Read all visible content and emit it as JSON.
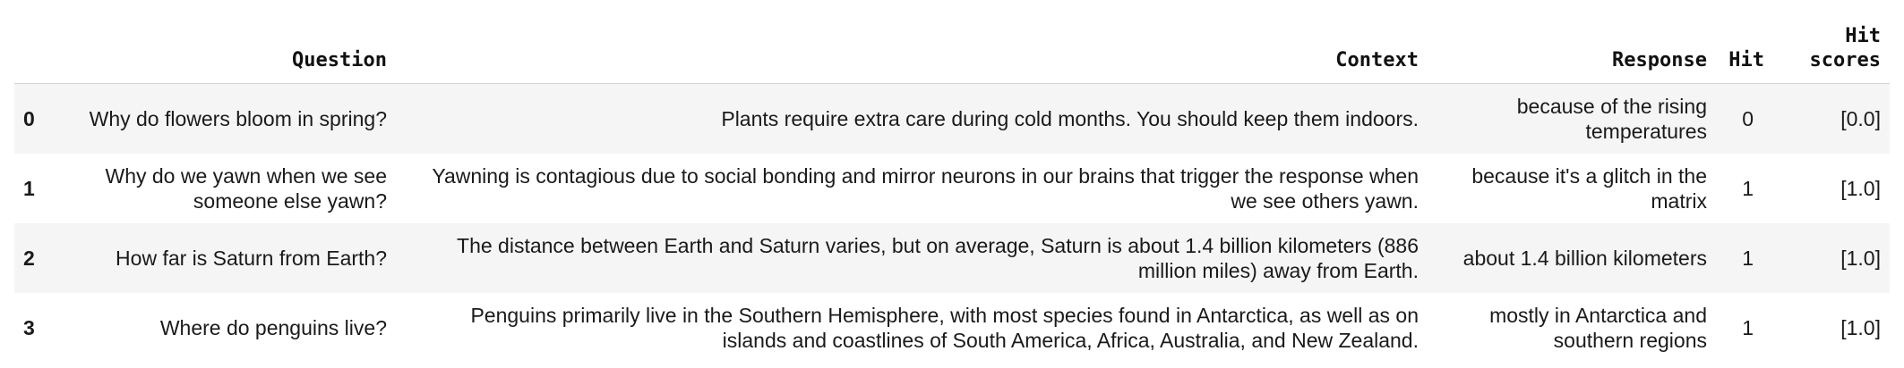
{
  "table": {
    "columns": [
      "",
      "Question",
      "Context",
      "Response",
      "Hit",
      "Hit scores"
    ],
    "header_hit_scores_line1": "Hit",
    "header_hit_scores_line2": "scores",
    "rows": [
      {
        "index": "0",
        "question": "Why do flowers bloom in spring?",
        "context": "Plants require extra care during cold months. You should keep them indoors.",
        "response": "because of the rising temperatures",
        "hit": "0",
        "hit_scores": "[0.0]"
      },
      {
        "index": "1",
        "question": "Why do we yawn when we see someone else yawn?",
        "context": "Yawning is contagious due to social bonding and mirror neurons in our brains that trigger the response when we see others yawn.",
        "response": "because it's a glitch in the matrix",
        "hit": "1",
        "hit_scores": "[1.0]"
      },
      {
        "index": "2",
        "question": "How far is Saturn from Earth?",
        "context": "The distance between Earth and Saturn varies, but on average, Saturn is about 1.4 billion kilometers (886 million miles) away from Earth.",
        "response": "about 1.4 billion kilometers",
        "hit": "1",
        "hit_scores": "[1.0]"
      },
      {
        "index": "3",
        "question": "Where do penguins live?",
        "context": "Penguins primarily live in the Southern Hemisphere, with most species found in Antarctica, as well as on islands and coastlines of South America, Africa, Australia, and New Zealand.",
        "response": "mostly in Antarctica and southern regions",
        "hit": "1",
        "hit_scores": "[1.0]"
      }
    ]
  }
}
